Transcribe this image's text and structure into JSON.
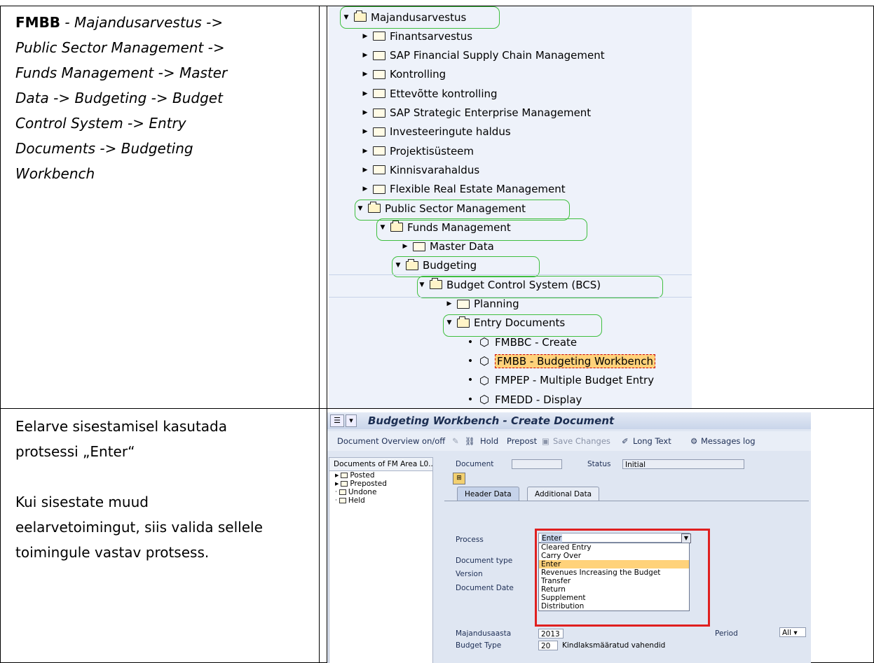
{
  "row1": {
    "code": "FMBB",
    "path_lines": [
      " - Majandusarvestus ->",
      "Public Sector Management ->",
      "Funds Management -> Master",
      "Data -> Budgeting -> Budget",
      "Control System -> Entry",
      "Documents -> Budgeting",
      "Workbench"
    ]
  },
  "tree": {
    "items": [
      {
        "label": "Majandusarvestus",
        "state": "open"
      },
      {
        "label": "Finantsarvestus",
        "state": "closed"
      },
      {
        "label": "SAP Financial Supply Chain Management",
        "state": "closed"
      },
      {
        "label": "Kontrolling",
        "state": "closed"
      },
      {
        "label": "Ettevõtte kontrolling",
        "state": "closed"
      },
      {
        "label": "SAP Strategic Enterprise Management",
        "state": "closed"
      },
      {
        "label": "Investeeringute haldus",
        "state": "closed"
      },
      {
        "label": "Projektisüsteem",
        "state": "closed"
      },
      {
        "label": "Kinnisvarahaldus",
        "state": "closed"
      },
      {
        "label": "Flexible Real Estate Management",
        "state": "closed"
      },
      {
        "label": "Public Sector Management",
        "state": "open"
      },
      {
        "label": "Funds Management",
        "state": "open"
      },
      {
        "label": "Master Data",
        "state": "closed"
      },
      {
        "label": "Budgeting",
        "state": "open"
      },
      {
        "label": "Budget Control System (BCS)",
        "state": "open"
      },
      {
        "label": "Planning",
        "state": "closed"
      },
      {
        "label": "Entry Documents",
        "state": "open"
      },
      {
        "label": "FMBBC - Create",
        "state": "leaf"
      },
      {
        "label": "FMBB - Budgeting Workbench",
        "state": "leaf"
      },
      {
        "label": "FMPEP - Multiple Budget Entry",
        "state": "leaf"
      },
      {
        "label": "FMEDD - Display",
        "state": "leaf"
      }
    ]
  },
  "row2": {
    "line1": "Eelarve sisestamisel kasutada",
    "line2": "protsessi „Enter“",
    "line3": "Kui sisestate muud",
    "line4": "eelarvetoimingut, siis valida sellele",
    "line5": "toimingule vastav protsess."
  },
  "sap": {
    "title": "Budgeting Workbench - Create Document",
    "toolbar": {
      "doc_overview": "Document Overview on/off",
      "hold": "Hold",
      "prepost": "Prepost",
      "save_changes": "Save Changes",
      "long_text": "Long Text",
      "messages_log": "Messages log"
    },
    "left_tree": {
      "header": "Documents of FM Area L0...",
      "items": [
        "Posted",
        "Preposted",
        "Undone",
        "Held"
      ]
    },
    "document_label": "Document",
    "status_label": "Status",
    "status_value": "Initial",
    "tabs": {
      "header": "Header Data",
      "additional": "Additional Data"
    },
    "process_label": "Process",
    "process_value": "Enter",
    "doc_type_label": "Document type",
    "version_label": "Version",
    "doc_date_label": "Document Date",
    "process_options": [
      "Cleared Entry",
      "Carry Over",
      "Enter",
      "Revenues Increasing the Budget",
      "Transfer",
      "Return",
      "Supplement",
      "Distribution"
    ],
    "year_label": "Majandusaasta",
    "year_value": "2013",
    "period_label": "Period",
    "period_value": "All",
    "budget_type_label": "Budget Type",
    "budget_type_code": "20",
    "budget_type_text": "Kindlaksmääratud vahendid"
  },
  "colors": {
    "green_circle": "#3fbf3f",
    "red_box": "#e02020",
    "highlight": "#ffd27a"
  }
}
